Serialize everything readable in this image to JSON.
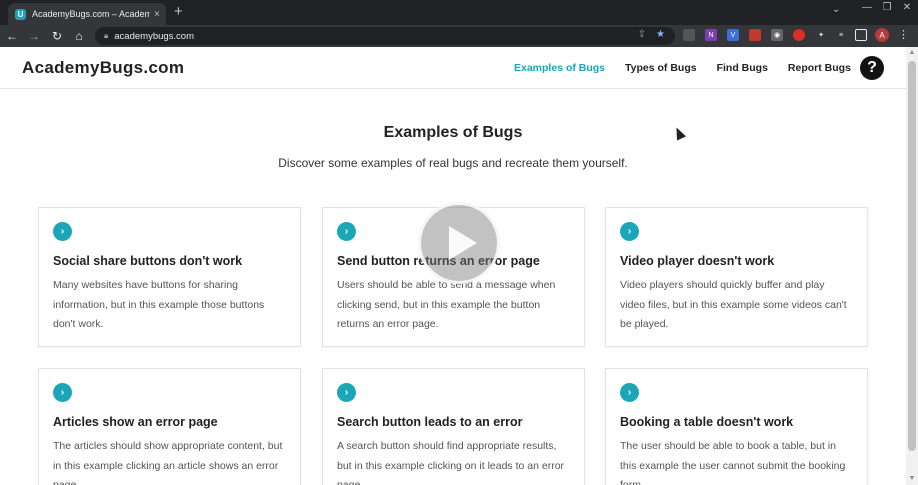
{
  "browser": {
    "tab_title": "AcademyBugs.com – Academy B",
    "favicon_letter": "U",
    "tab_close": "×",
    "new_tab": "+",
    "url": "academybugs.com",
    "window_controls": [
      "—",
      "❐",
      "✕"
    ],
    "profile_initial": "A",
    "extension_icons": [
      "extension-1-icon",
      "onenote-icon",
      "v-icon",
      "red-icon",
      "camera-icon",
      "rec-icon",
      "puzzle-icon",
      "playlist-icon",
      "sidepanel-icon"
    ]
  },
  "header": {
    "logo": "AcademyBugs.com",
    "nav": {
      "examples": "Examples of Bugs",
      "types": "Types of Bugs",
      "find": "Find Bugs",
      "report": "Report Bugs"
    },
    "help": "?"
  },
  "main": {
    "title": "Examples of Bugs",
    "subtitle": "Discover some examples of real bugs and recreate them yourself."
  },
  "cards": [
    {
      "title": "Social share buttons don't work",
      "desc": "Many websites have buttons for sharing information, but in this example those buttons don't work."
    },
    {
      "title": "Send button returns an error page",
      "desc": "Users should be able to send a message when clicking send, but in this example the button returns an error page."
    },
    {
      "title": "Video player doesn't work",
      "desc": "Video players should quickly buffer and play video files, but in this example some videos can't be played."
    },
    {
      "title": "Articles show an error page",
      "desc": "The articles should show appropriate content, but in this example clicking an article shows an error page."
    },
    {
      "title": "Search button leads to an error",
      "desc": "A search button should find appropriate results, but in this example clicking on it leads to an error page."
    },
    {
      "title": "Booking a table doesn't work",
      "desc": "The user should be able to book a table, but in this example the user cannot submit the booking form."
    }
  ],
  "colors": {
    "accent": "#1aa6b7",
    "chrome_dark": "#202124",
    "chrome_toolbar": "#35363a"
  }
}
